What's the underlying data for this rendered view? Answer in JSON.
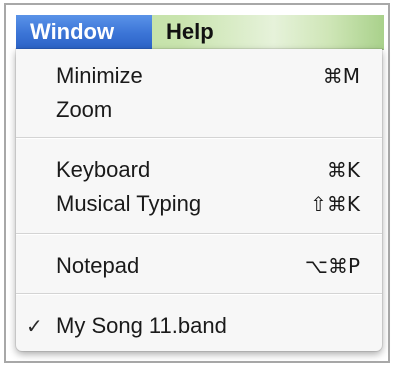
{
  "menubar": {
    "items": [
      {
        "label": "Window",
        "active": true
      },
      {
        "label": "Help",
        "active": false
      }
    ],
    "colors": {
      "active_bg": "#3b74d6",
      "bar_bg": "#c9e4ae"
    }
  },
  "menu": {
    "items": [
      {
        "label": "Minimize",
        "shortcut": "⌘M"
      },
      {
        "label": "Zoom",
        "shortcut": ""
      },
      {
        "label": "Keyboard",
        "shortcut": "⌘K"
      },
      {
        "label": "Musical Typing",
        "shortcut": "⇧⌘K"
      },
      {
        "label": "Notepad",
        "shortcut": "⌥⌘P"
      },
      {
        "label": "My Song 11.band",
        "shortcut": "",
        "checked": true,
        "check_mark": "✓"
      }
    ]
  }
}
